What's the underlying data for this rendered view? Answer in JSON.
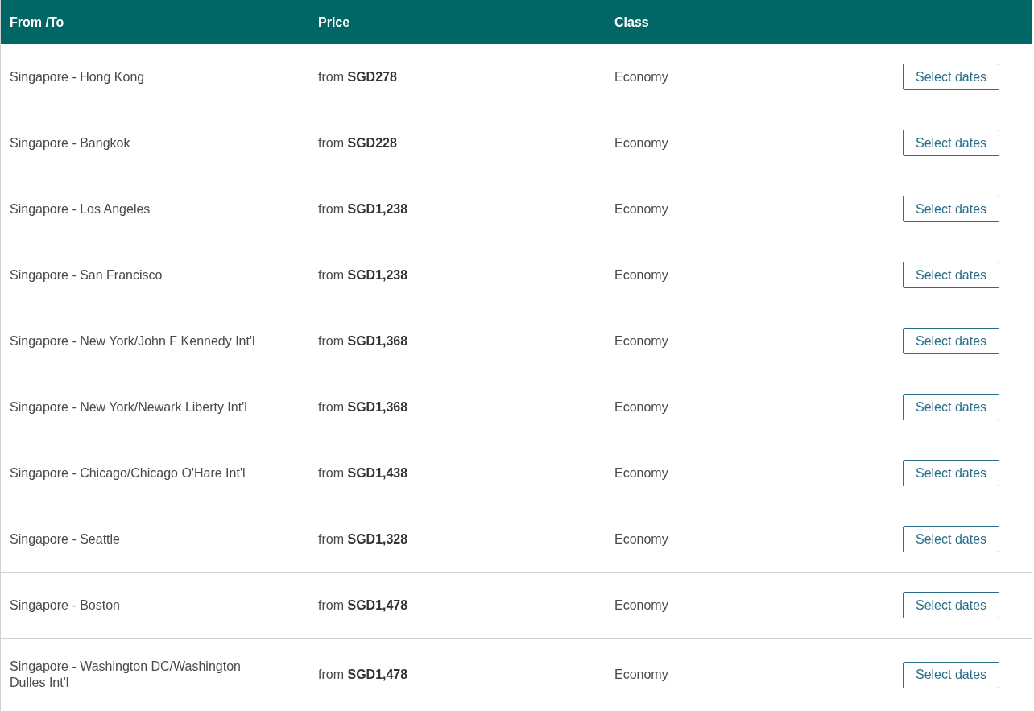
{
  "table": {
    "columns": [
      "From /To",
      "Price",
      "Class"
    ],
    "rows": [
      {
        "route": "Singapore - Hong Kong",
        "price": "from **SGD278**",
        "class": "Economy",
        "action": "Select dates"
      },
      {
        "route": "Singapore - Bangkok",
        "price": "from **SGD228**",
        "class": "Economy",
        "action": "Select dates"
      },
      {
        "route": "Singapore - Los Angeles",
        "price": "from **SGD1,238**",
        "class": "Economy",
        "action": "Select dates"
      },
      {
        "route": "Singapore - San Francisco",
        "price": "from **SGD1,238**",
        "class": "Economy",
        "action": "Select dates"
      },
      {
        "route": "Singapore - New York/John F Kennedy Int'l",
        "price": "from **SGD1,368**",
        "class": "Economy",
        "action": "Select dates"
      },
      {
        "route": "Singapore - New York/Newark Liberty Int'l",
        "price": "from **SGD1,368**",
        "class": "Economy",
        "action": "Select dates"
      },
      {
        "route": "Singapore - Chicago/Chicago O'Hare Int'l",
        "price": "from **SGD1,438**",
        "class": "Economy",
        "action": "Select dates"
      },
      {
        "route": "Singapore - Seattle",
        "price": "from **SGD1,328**",
        "class": "Economy",
        "action": "Select dates"
      },
      {
        "route": "Singapore - Boston",
        "price": "from **SGD1,478**",
        "class": "Economy",
        "action": "Select dates"
      },
      {
        "route": "Singapore - Washington DC/Washington Dulles Int'l",
        "price": "from **SGD1,478**",
        "class": "Economy",
        "action": "Select dates"
      }
    ]
  }
}
